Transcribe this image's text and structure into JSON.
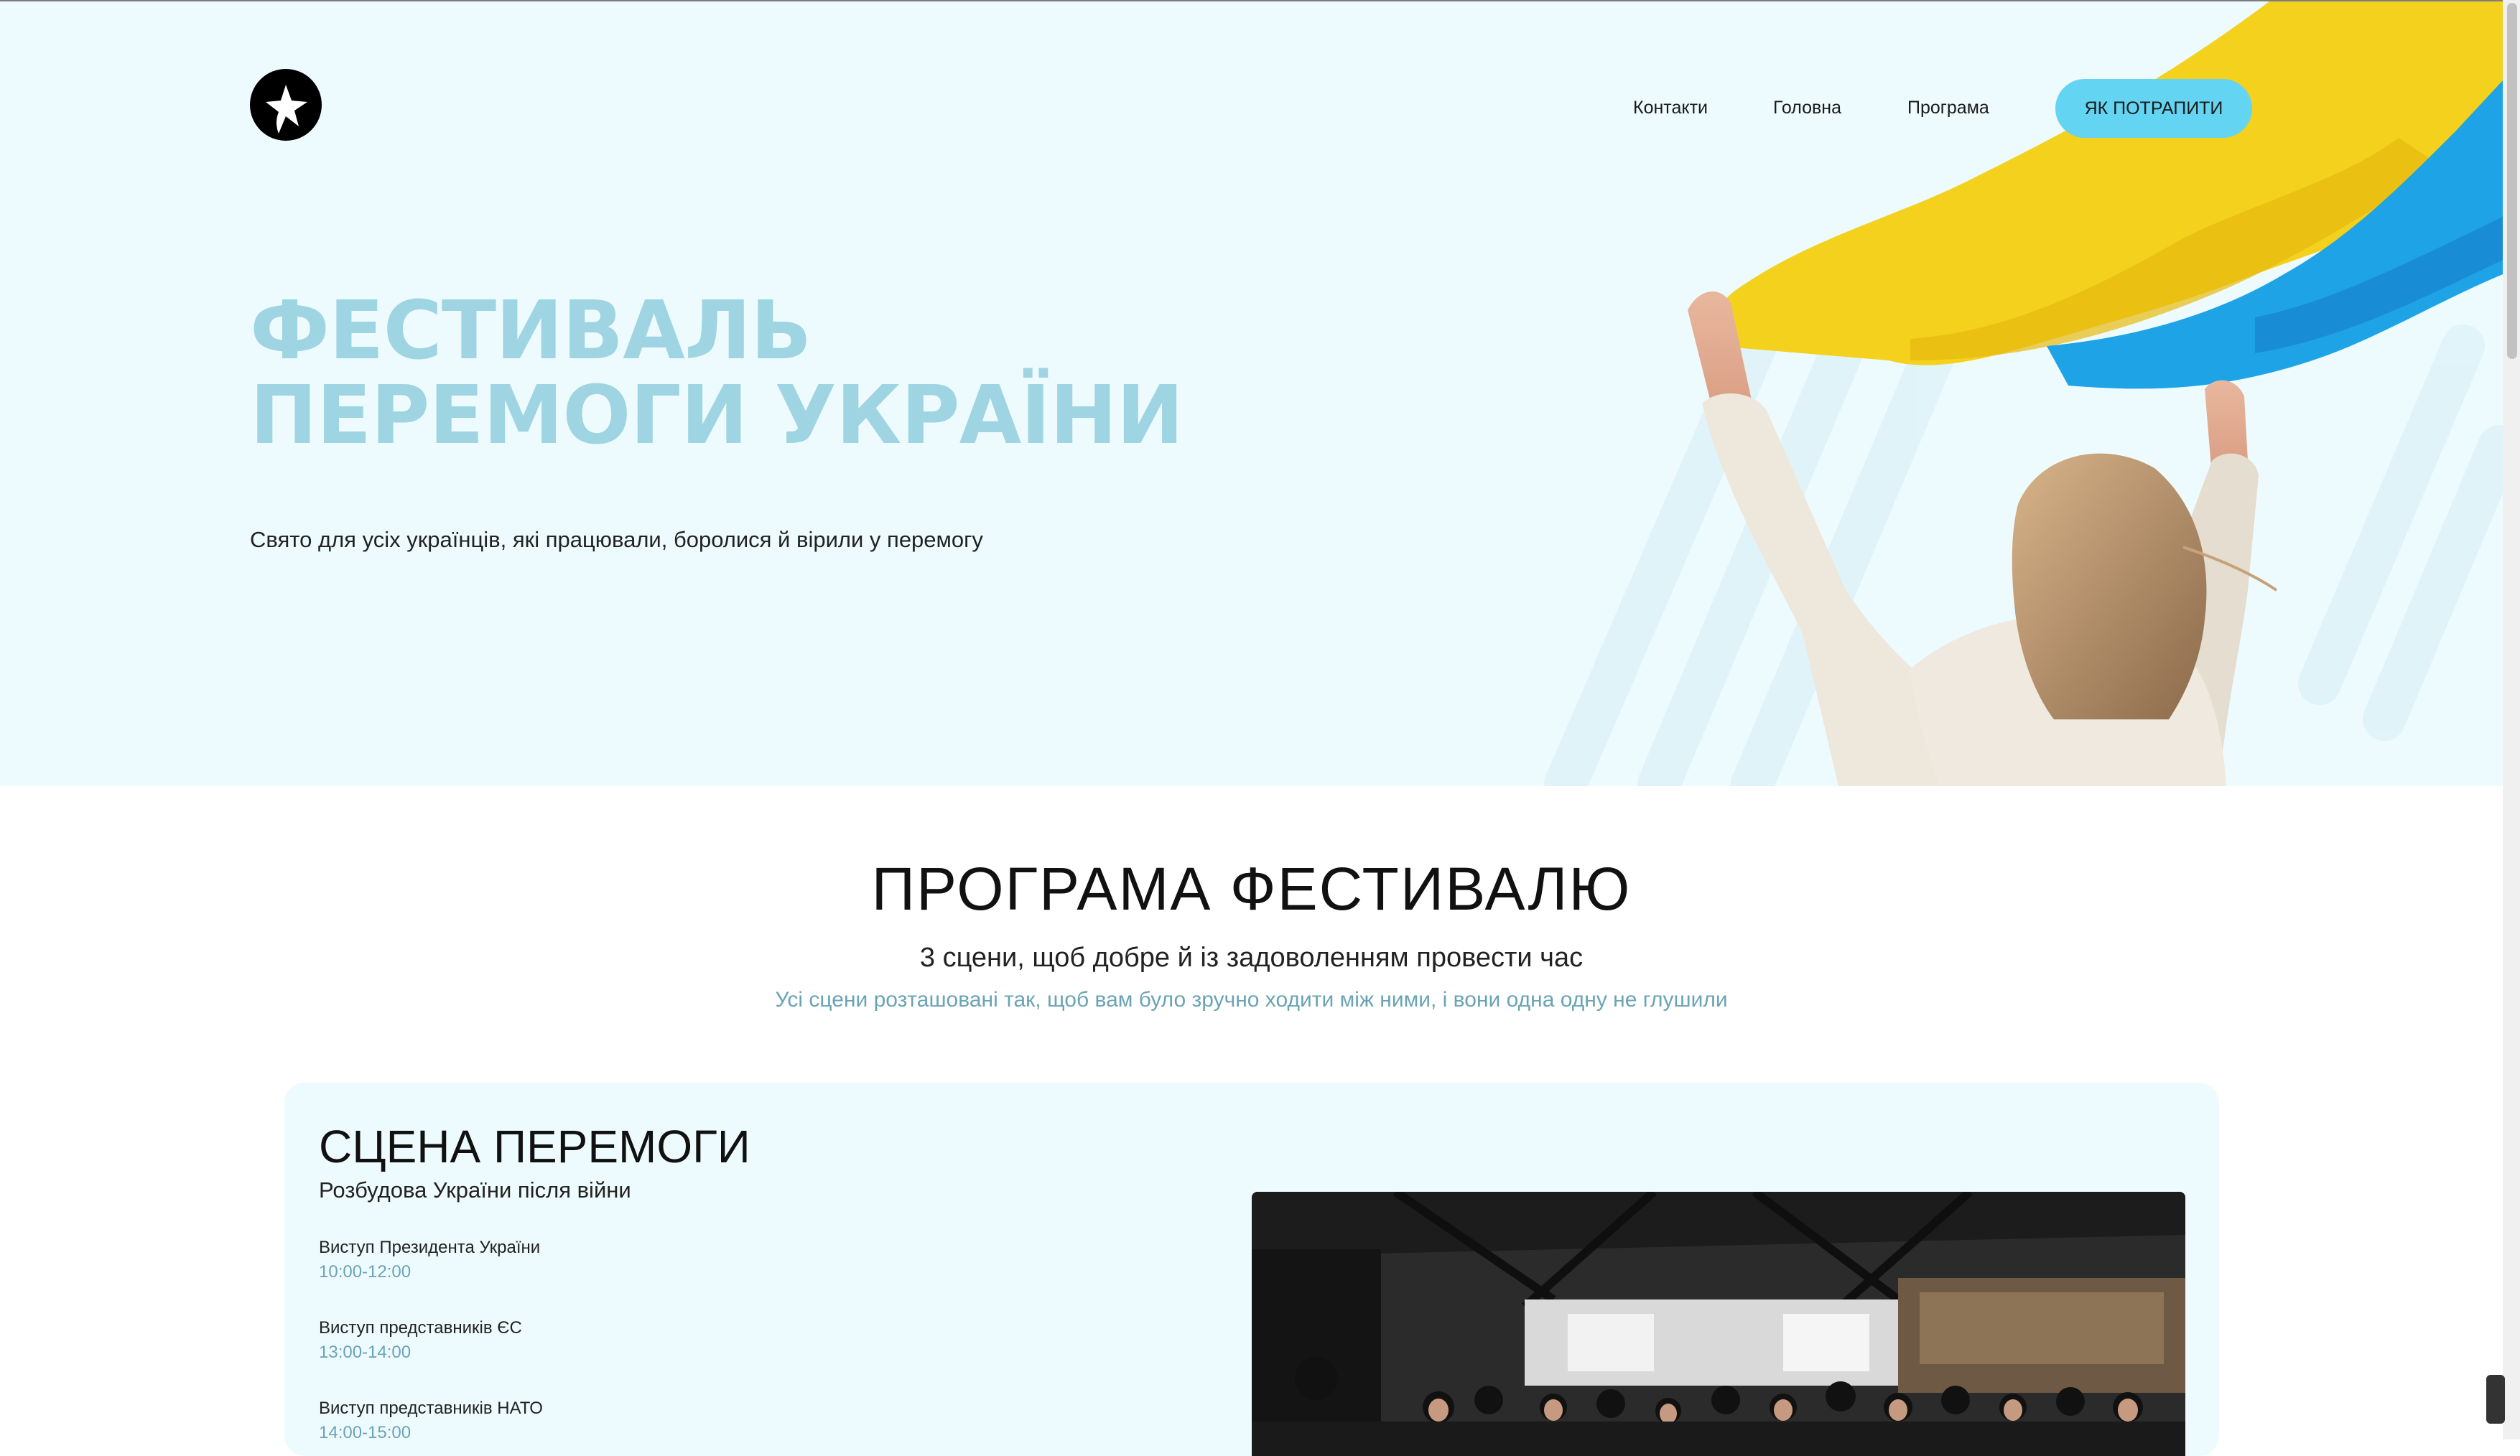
{
  "nav": {
    "links": [
      "Контакти",
      "Головна",
      "Програма"
    ],
    "cta_label": "ЯК ПОТРАПИТИ"
  },
  "hero": {
    "title_line1": "ФЕСТИВАЛЬ",
    "title_line2": "ПЕРЕМОГИ УКРАЇНИ",
    "subtitle": "Свято для усіх українців, які працювали, боролися й вірили у перемогу"
  },
  "program": {
    "title": "ПРОГРАМА ФЕСТИВАЛЮ",
    "subtitle": "3 сцени, щоб добре й із задоволенням провести час",
    "description": "Усі сцени розташовані так, щоб вам було зручно ходити між ними, і вони одна одну не глушили"
  },
  "stage": {
    "title": "СЦЕНА ПЕРЕМОГИ",
    "subtitle": "Розбудова України після війни",
    "events": [
      {
        "name": "Виступ Президента України",
        "time": "10:00-12:00"
      },
      {
        "name": "Виступ представників ЄС",
        "time": "13:00-14:00"
      },
      {
        "name": "Виступ представників НАТО",
        "time": "14:00-15:00"
      }
    ]
  },
  "colors": {
    "hero_bg": "#eefbfe",
    "accent": "#63d4f2",
    "title_color": "#9fd5e2",
    "time_color": "#6aa4b4",
    "flag_yellow": "#f2cf1f",
    "flag_blue": "#1ea4e6"
  },
  "icons": {
    "logo": "star-in-circle-logo"
  }
}
